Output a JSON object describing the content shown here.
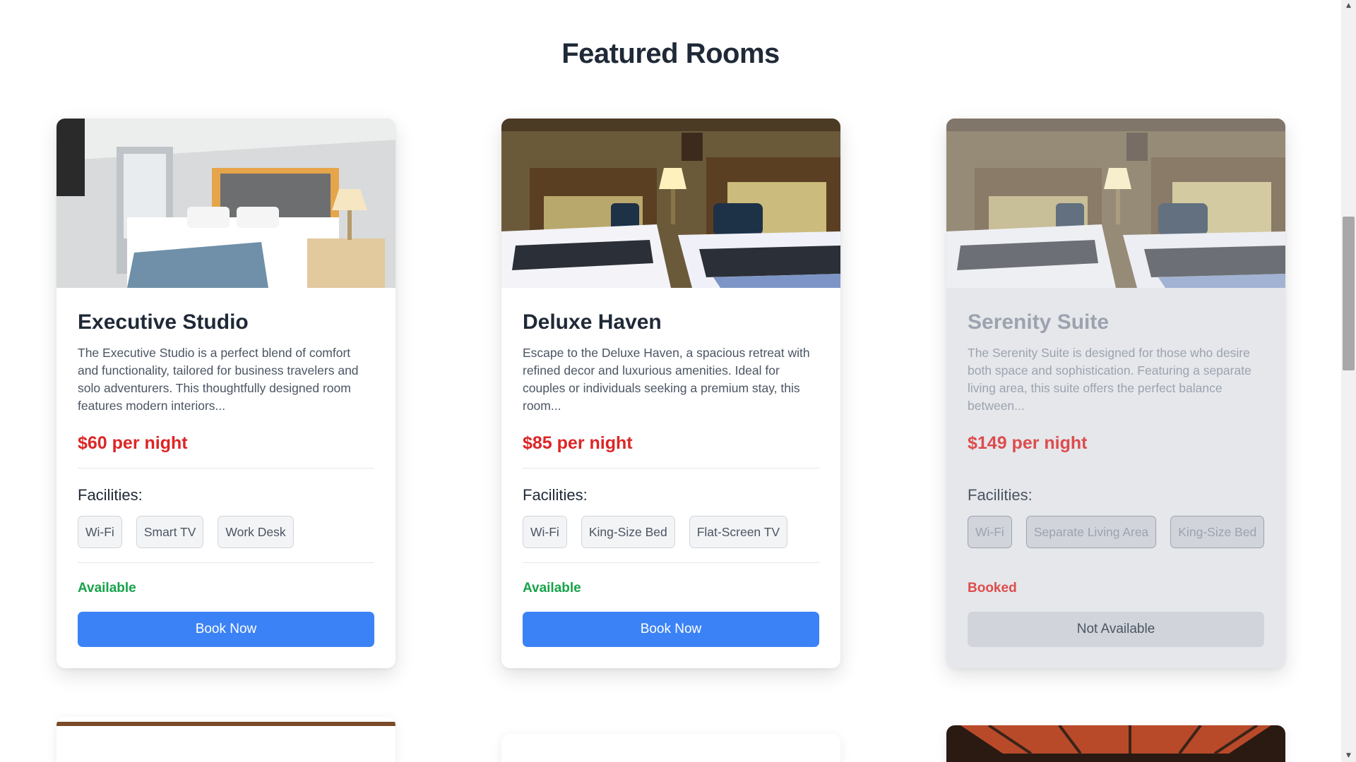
{
  "section": {
    "title": "Featured Rooms"
  },
  "rooms": [
    {
      "name": "Executive Studio",
      "description": "The Executive Studio is a perfect blend of comfort and functionality, tailored for business travelers and solo adventurers. This thoughtfully designed room features modern interiors...",
      "price": "$60 per night",
      "facilities_label": "Facilities:",
      "facilities": [
        "Wi-Fi",
        "Smart TV",
        "Work Desk"
      ],
      "status": "Available",
      "button": "Book Now"
    },
    {
      "name": "Deluxe Haven",
      "description": "Escape to the Deluxe Haven, a spacious retreat with refined decor and luxurious amenities. Ideal for couples or individuals seeking a premium stay, this room...",
      "price": "$85 per night",
      "facilities_label": "Facilities:",
      "facilities": [
        "Wi-Fi",
        "King-Size Bed",
        "Flat-Screen TV"
      ],
      "status": "Available",
      "button": "Book Now"
    },
    {
      "name": "Serenity Suite",
      "description": "The Serenity Suite is designed for those who desire both space and sophistication. Featuring a separate living area, this suite offers the perfect balance between...",
      "price": "$149 per night",
      "facilities_label": "Facilities:",
      "facilities": [
        "Wi-Fi",
        "Separate Living Area",
        "King-Size Bed"
      ],
      "status": "Booked",
      "button": "Not Available"
    }
  ],
  "colors": {
    "accent": "#3b82f6",
    "price": "#dc2626",
    "available": "#16a34a",
    "booked": "#dc2626"
  },
  "scrollbar": {
    "up_icon": "triangle-up-icon",
    "down_icon": "triangle-down-icon"
  }
}
